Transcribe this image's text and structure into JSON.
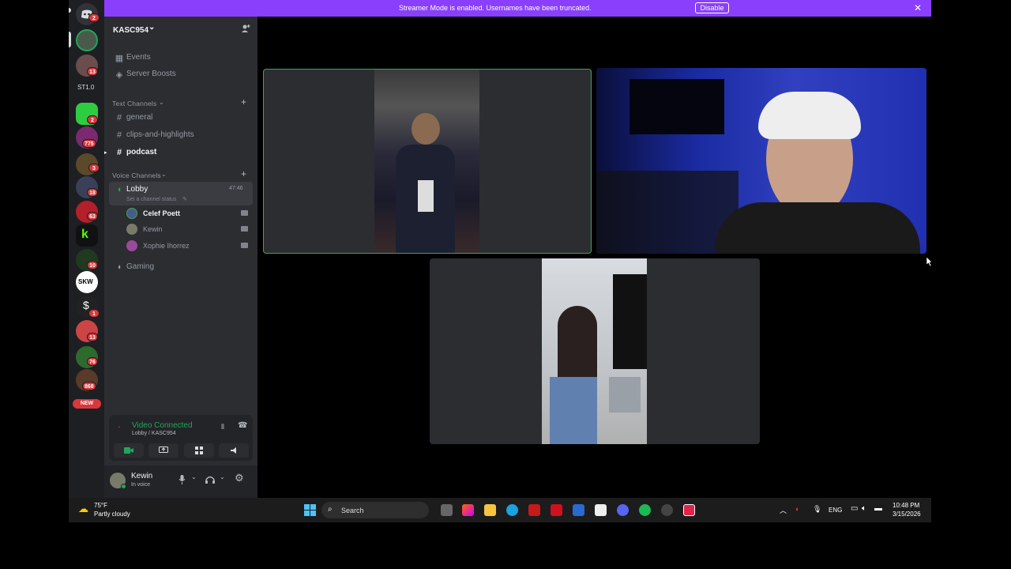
{
  "banner": {
    "text": "Streamer Mode is enabled. Usernames have been truncated.",
    "button": "Disable",
    "close": "✕"
  },
  "rail": {
    "badges": [
      "2",
      "13",
      "2",
      "775",
      "3",
      "18",
      "63",
      "10",
      "1",
      "13",
      "76",
      "868"
    ],
    "st_label": "ST1.0",
    "new_label": "NEW"
  },
  "server": {
    "name": "KASC954",
    "chevron": "⌄"
  },
  "menu": {
    "events": "Events",
    "boosts": "Server Boosts"
  },
  "categories": {
    "text": "Text Channels",
    "voice": "Voice Channels"
  },
  "text_channels": [
    {
      "name": "general"
    },
    {
      "name": "clips-and-highlights"
    },
    {
      "name": "podcast"
    }
  ],
  "voice": {
    "lobby": {
      "name": "Lobby",
      "timer": "47:46",
      "status_hint": "Set a channel status"
    },
    "members": [
      {
        "name": "Celef Poett"
      },
      {
        "name": "Kewin"
      },
      {
        "name": "Xophie Ihorrez"
      }
    ],
    "gaming": {
      "name": "Gaming"
    }
  },
  "voice_panel": {
    "status": "Video Connected",
    "location": "Lobby / KASC954"
  },
  "user": {
    "name": "Kewin",
    "status": "In voice"
  },
  "weather": {
    "temp": "75°F",
    "desc": "Partly cloudy"
  },
  "taskbar": {
    "search": "Search",
    "lang": "ENG",
    "time": "10:48 PM",
    "date": "3/15/2026"
  },
  "colors": {
    "accent": "#8a3ffc",
    "voice_green": "#23a55a",
    "speaking": "#3ba55d"
  }
}
